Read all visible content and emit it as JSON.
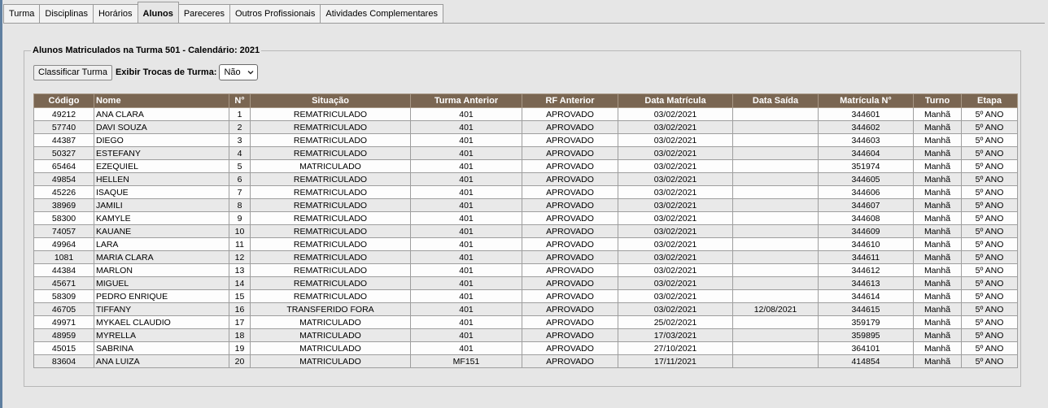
{
  "tabs": [
    {
      "label": "Turma",
      "active": false
    },
    {
      "label": "Disciplinas",
      "active": false
    },
    {
      "label": "Horários",
      "active": false
    },
    {
      "label": "Alunos",
      "active": true
    },
    {
      "label": "Pareceres",
      "active": false
    },
    {
      "label": "Outros Profissionais",
      "active": false
    },
    {
      "label": "Atividades Complementares",
      "active": false
    }
  ],
  "panel": {
    "legend": "Alunos Matriculados na Turma 501 - Calendário: 2021",
    "classify_button": "Classificar Turma",
    "swap_label": "Exibir Trocas de Turma:",
    "swap_value": "Não"
  },
  "colors": {
    "header_bg": "#7a6652",
    "header_text": "#ffffff",
    "even_row": "#e9e9e9"
  },
  "table": {
    "columns": [
      "Código",
      "Nome",
      "N°",
      "Situação",
      "Turma Anterior",
      "RF Anterior",
      "Data Matrícula",
      "Data Saída",
      "Matrícula N°",
      "Turno",
      "Etapa"
    ],
    "rows": [
      [
        "49212",
        "ANA CLARA",
        "1",
        "REMATRICULADO",
        "401",
        "APROVADO",
        "03/02/2021",
        "",
        "344601",
        "Manhã",
        "5º ANO"
      ],
      [
        "57740",
        "DAVI SOUZA",
        "2",
        "REMATRICULADO",
        "401",
        "APROVADO",
        "03/02/2021",
        "",
        "344602",
        "Manhã",
        "5º ANO"
      ],
      [
        "44387",
        "DIEGO",
        "3",
        "REMATRICULADO",
        "401",
        "APROVADO",
        "03/02/2021",
        "",
        "344603",
        "Manhã",
        "5º ANO"
      ],
      [
        "50327",
        "ESTEFANY",
        "4",
        "REMATRICULADO",
        "401",
        "APROVADO",
        "03/02/2021",
        "",
        "344604",
        "Manhã",
        "5º ANO"
      ],
      [
        "65464",
        "EZEQUIEL",
        "5",
        "MATRICULADO",
        "401",
        "APROVADO",
        "03/02/2021",
        "",
        "351974",
        "Manhã",
        "5º ANO"
      ],
      [
        "49854",
        "HELLEN",
        "6",
        "REMATRICULADO",
        "401",
        "APROVADO",
        "03/02/2021",
        "",
        "344605",
        "Manhã",
        "5º ANO"
      ],
      [
        "45226",
        "ISAQUE",
        "7",
        "REMATRICULADO",
        "401",
        "APROVADO",
        "03/02/2021",
        "",
        "344606",
        "Manhã",
        "5º ANO"
      ],
      [
        "38969",
        "JAMILI",
        "8",
        "REMATRICULADO",
        "401",
        "APROVADO",
        "03/02/2021",
        "",
        "344607",
        "Manhã",
        "5º ANO"
      ],
      [
        "58300",
        "KAMYLE",
        "9",
        "REMATRICULADO",
        "401",
        "APROVADO",
        "03/02/2021",
        "",
        "344608",
        "Manhã",
        "5º ANO"
      ],
      [
        "74057",
        "KAUANE",
        "10",
        "REMATRICULADO",
        "401",
        "APROVADO",
        "03/02/2021",
        "",
        "344609",
        "Manhã",
        "5º ANO"
      ],
      [
        "49964",
        "LARA",
        "11",
        "REMATRICULADO",
        "401",
        "APROVADO",
        "03/02/2021",
        "",
        "344610",
        "Manhã",
        "5º ANO"
      ],
      [
        "1081",
        "MARIA CLARA",
        "12",
        "REMATRICULADO",
        "401",
        "APROVADO",
        "03/02/2021",
        "",
        "344611",
        "Manhã",
        "5º ANO"
      ],
      [
        "44384",
        "MARLON",
        "13",
        "REMATRICULADO",
        "401",
        "APROVADO",
        "03/02/2021",
        "",
        "344612",
        "Manhã",
        "5º ANO"
      ],
      [
        "45671",
        "MIGUEL",
        "14",
        "REMATRICULADO",
        "401",
        "APROVADO",
        "03/02/2021",
        "",
        "344613",
        "Manhã",
        "5º ANO"
      ],
      [
        "58309",
        "PEDRO ENRIQUE",
        "15",
        "REMATRICULADO",
        "401",
        "APROVADO",
        "03/02/2021",
        "",
        "344614",
        "Manhã",
        "5º ANO"
      ],
      [
        "46705",
        "TIFFANY",
        "16",
        "TRANSFERIDO FORA",
        "401",
        "APROVADO",
        "03/02/2021",
        "12/08/2021",
        "344615",
        "Manhã",
        "5º ANO"
      ],
      [
        "49971",
        "MYKAEL CLAUDIO",
        "17",
        "MATRICULADO",
        "401",
        "APROVADO",
        "25/02/2021",
        "",
        "359179",
        "Manhã",
        "5º ANO"
      ],
      [
        "48959",
        "MYRELLA",
        "18",
        "MATRICULADO",
        "401",
        "APROVADO",
        "17/03/2021",
        "",
        "359895",
        "Manhã",
        "5º ANO"
      ],
      [
        "45015",
        "SABRINA",
        "19",
        "MATRICULADO",
        "401",
        "APROVADO",
        "27/10/2021",
        "",
        "364101",
        "Manhã",
        "5º ANO"
      ],
      [
        "83604",
        "ANA LUIZA",
        "20",
        "MATRICULADO",
        "MF151",
        "APROVADO",
        "17/11/2021",
        "",
        "414854",
        "Manhã",
        "5º ANO"
      ]
    ]
  }
}
